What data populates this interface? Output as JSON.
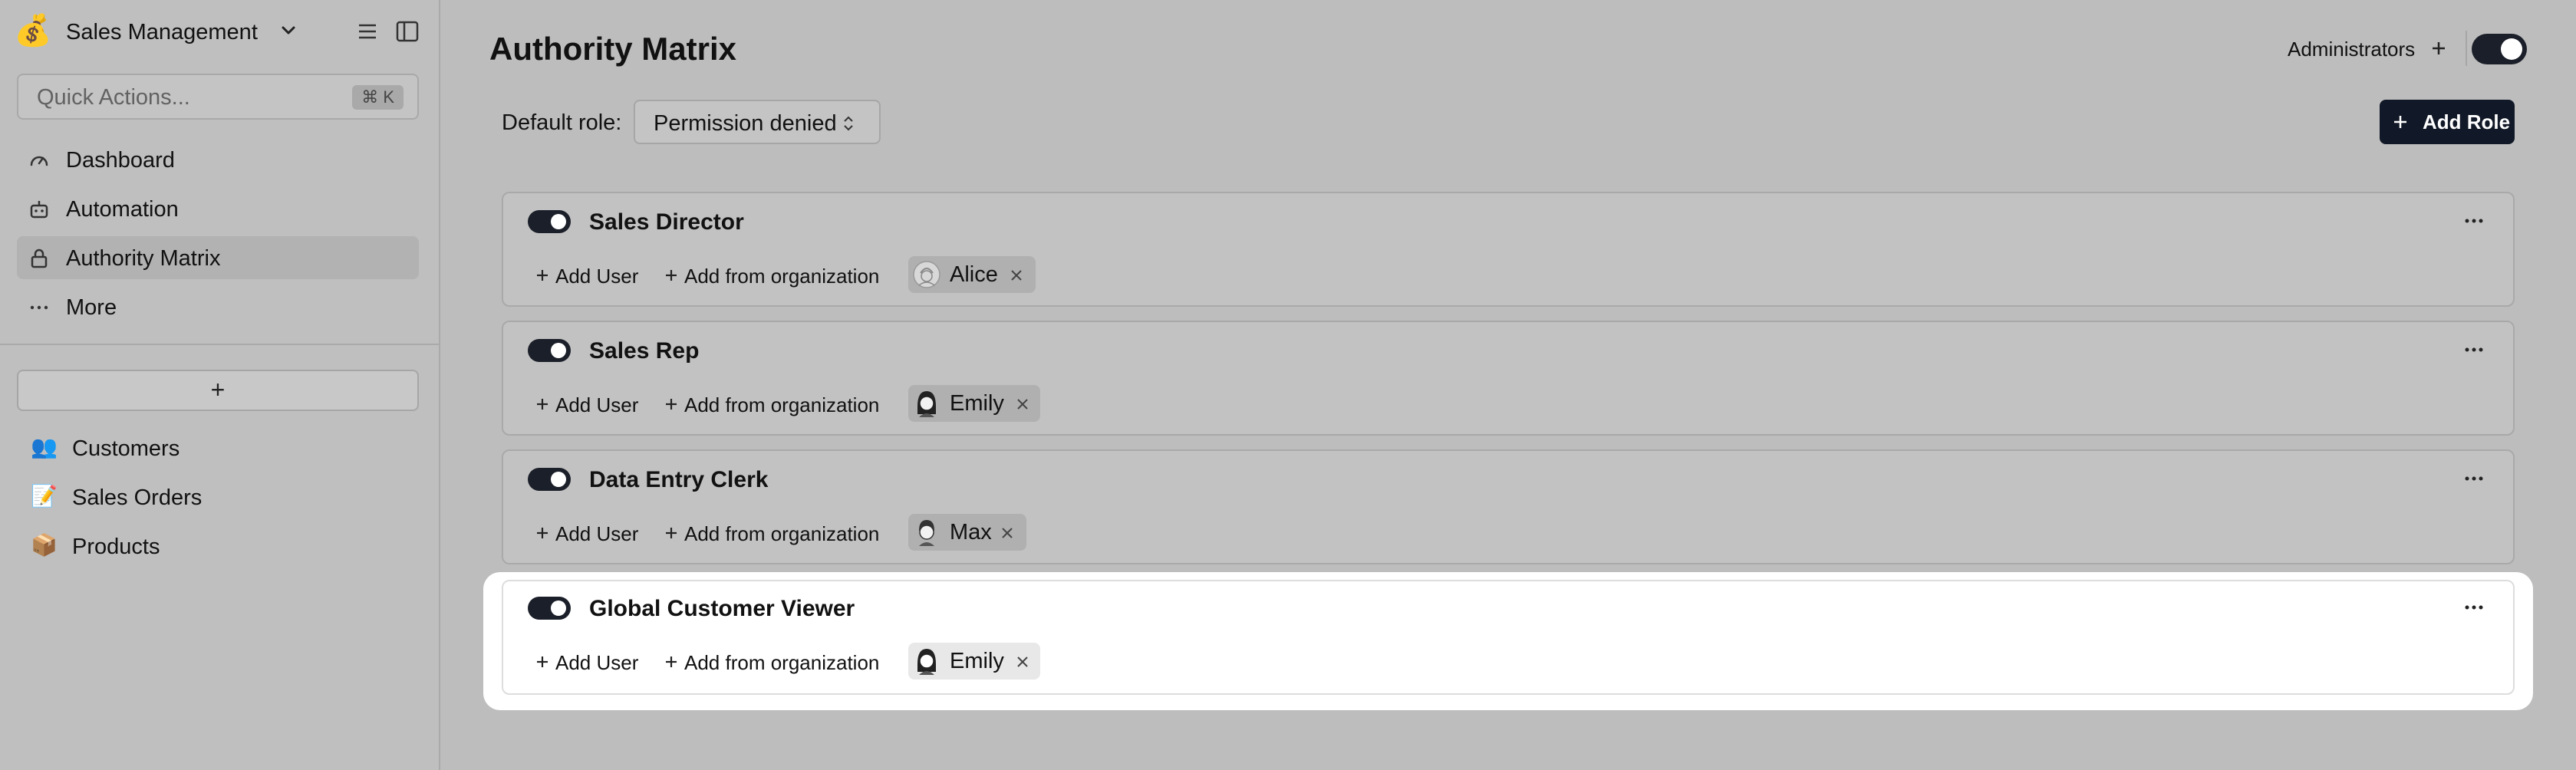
{
  "app": {
    "title": "Sales Management",
    "logo_icon": "money-bag-emoji"
  },
  "sidebar": {
    "quick_actions": {
      "placeholder": "Quick Actions...",
      "shortcut": "⌘ K"
    },
    "nav": [
      {
        "label": "Dashboard",
        "icon": "gauge-icon"
      },
      {
        "label": "Automation",
        "icon": "robot-icon"
      },
      {
        "label": "Authority Matrix",
        "icon": "lock-icon",
        "active": true
      },
      {
        "label": "More",
        "icon": "more-dots-icon"
      }
    ],
    "add_label": "+",
    "collections": [
      {
        "label": "Customers",
        "emoji": "👥"
      },
      {
        "label": "Sales Orders",
        "emoji": "📝"
      },
      {
        "label": "Products",
        "emoji": "📦"
      }
    ]
  },
  "main": {
    "title": "Authority Matrix",
    "administrators_label": "Administrators",
    "admin_toggle_on": true,
    "default_role_label": "Default role:",
    "default_role_value": "Permission denied",
    "add_role_label": "Add Role",
    "add_user_label": "Add User",
    "add_from_org_label": "Add from organization",
    "roles": [
      {
        "name": "Sales Director",
        "enabled": true,
        "user": "Alice"
      },
      {
        "name": "Sales Rep",
        "enabled": true,
        "user": "Emily"
      },
      {
        "name": "Data Entry Clerk",
        "enabled": true,
        "user": "Max"
      },
      {
        "name": "Global Customer Viewer",
        "enabled": true,
        "user": "Emily",
        "highlighted": true
      }
    ]
  },
  "colors": {
    "accent_dark": "#111827",
    "toggle_on": "#1b1f29",
    "background": "#bdbdbd"
  }
}
